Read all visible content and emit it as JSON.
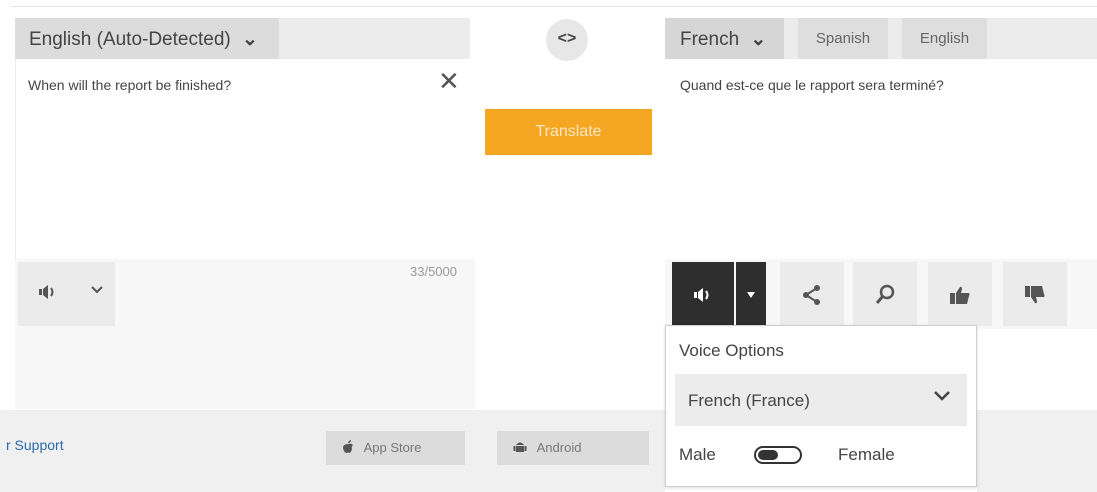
{
  "source": {
    "language_button": "English (Auto-Detected)",
    "language_chevron": "⌄",
    "text": "When will the report be finished?",
    "clear_icon": "✕",
    "char_count": "33/5000",
    "speak_icon": "speaker",
    "speak_chevron": "⌄"
  },
  "middle": {
    "swap_label": "<>",
    "translate_button": "Translate"
  },
  "target": {
    "language_button": "French",
    "language_chevron": "⌄",
    "quick_tabs": [
      "Spanish",
      "English"
    ],
    "text": "Quand est-ce que le rapport sera terminé?",
    "toolbar_icons": [
      "speaker",
      "dropdown",
      "share",
      "search",
      "thumbs-up",
      "thumbs-down"
    ]
  },
  "voice_options": {
    "title": "Voice Options",
    "selected_voice": "French (France)",
    "male_label": "Male",
    "female_label": "Female",
    "gender_toggle": "male"
  },
  "footer": {
    "support_link": "r Support",
    "app_store": "App Store",
    "android": "Android"
  },
  "colors": {
    "translate_button": "#f5a623",
    "speaker_active": "#2e2e2e",
    "link": "#2a6ab3"
  }
}
